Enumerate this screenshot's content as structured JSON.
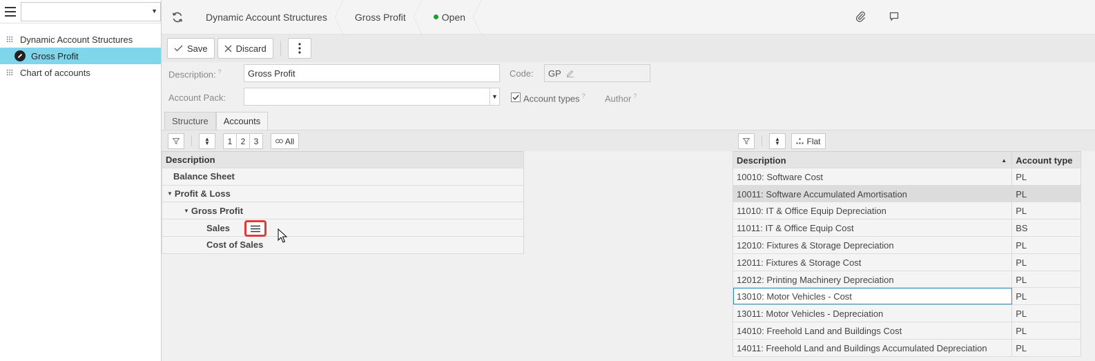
{
  "sidebar": {
    "select_value": "",
    "items": [
      {
        "label": "Dynamic Account Structures"
      },
      {
        "label": "Gross Profit"
      },
      {
        "label": "Chart of accounts"
      }
    ]
  },
  "topbar": {
    "breadcrumbs": [
      "Dynamic Account Structures",
      "Gross Profit"
    ],
    "status": "Open"
  },
  "toolbar": {
    "save": "Save",
    "discard": "Discard"
  },
  "form": {
    "description_label": "Description:",
    "description_value": "Gross Profit",
    "code_label": "Code:",
    "code_value": "GP",
    "account_pack_label": "Account Pack:",
    "account_pack_value": "",
    "account_types_label": "Account types",
    "author_label": "Author",
    "help_mark": "?"
  },
  "tabs": [
    {
      "label": "Structure"
    },
    {
      "label": "Accounts"
    }
  ],
  "left_grid": {
    "levels": [
      "1",
      "2",
      "3"
    ],
    "all_label": "All",
    "header": "Description",
    "rows": [
      {
        "label": "Balance Sheet"
      },
      {
        "label": "Profit & Loss"
      },
      {
        "label": "Gross Profit"
      },
      {
        "label": "Sales"
      },
      {
        "label": "Cost of Sales"
      }
    ]
  },
  "right_grid": {
    "flat_label": "Flat",
    "headers": [
      "Description",
      "Account type"
    ],
    "rows": [
      {
        "desc": "10010: Software Cost",
        "type": "PL"
      },
      {
        "desc": "10011: Software Accumulated Amortisation",
        "type": "PL"
      },
      {
        "desc": "11010: IT & Office Equip Depreciation",
        "type": "PL"
      },
      {
        "desc": "11011: IT & Office Equip Cost",
        "type": "BS"
      },
      {
        "desc": "12010: Fixtures & Storage Depreciation",
        "type": "PL"
      },
      {
        "desc": "12011: Fixtures & Storage Cost",
        "type": "PL"
      },
      {
        "desc": "12012: Printing Machinery Depreciation",
        "type": "PL"
      },
      {
        "desc": "13010: Motor Vehicles - Cost",
        "type": "PL"
      },
      {
        "desc": "13011: Motor Vehicles - Depreciation",
        "type": "PL"
      },
      {
        "desc": "14010: Freehold Land and Buildings Cost",
        "type": "PL"
      },
      {
        "desc": "14011: Freehold Land and Buildings Accumulated Depreciation",
        "type": "PL"
      }
    ]
  }
}
